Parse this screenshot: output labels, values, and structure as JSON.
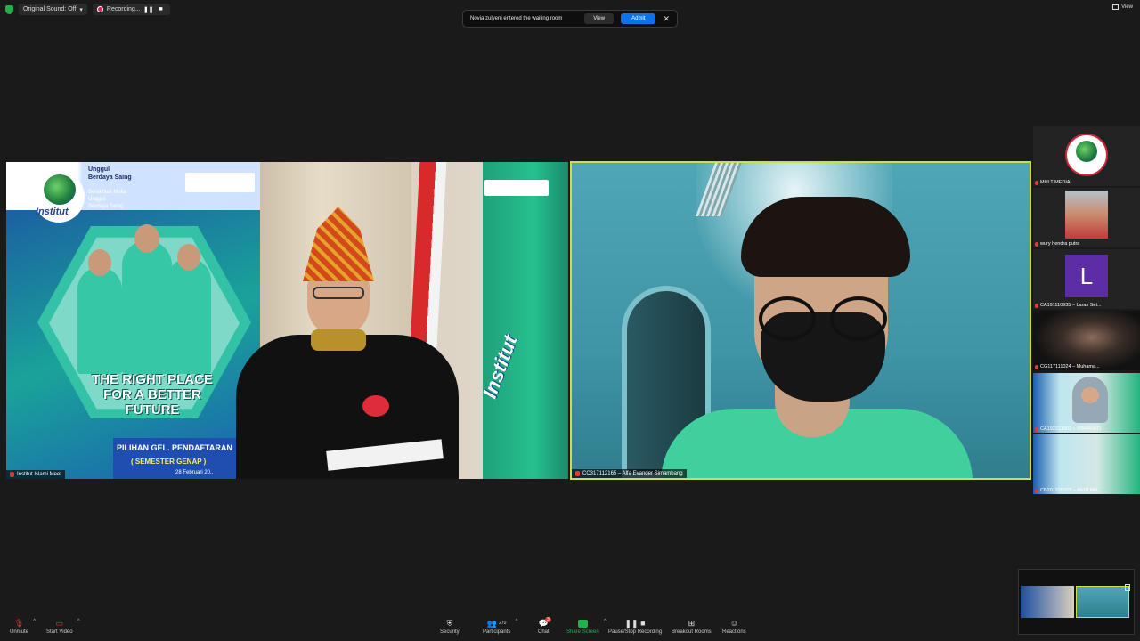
{
  "topbar": {
    "sound_label": "Original Sound: Off",
    "recording_label": "Recording...",
    "view_label": "View"
  },
  "notification": {
    "message": "Novia zulyeni entered the waiting room",
    "view_label": "View",
    "admit_label": "Admit"
  },
  "main_videos": [
    {
      "name": "Institut Islami Meet"
    },
    {
      "name": "CC317112165 – Alfa Evander Simambang"
    }
  ],
  "banner": {
    "logo_text": "Institut",
    "tagline_top": "Unggul\nBerdaya Saing",
    "tagline_sub": "Berakhlak Mulia\nUnggul\nBerdaya Saing",
    "slogan": "THE RIGHT PLACE\nFOR A BETTER\nFUTURE",
    "ribbon_title": "PILIHAN GEL. PENDAFTARAN",
    "ribbon_sub": "( SEMESTER GENAP )",
    "ribbon_date": "28 Februari 20..",
    "flag_text": "Institut"
  },
  "participants": [
    {
      "name": "MULTIMEDIA"
    },
    {
      "name": "wury hendra putra"
    },
    {
      "name": "CA191110935 – Laras Set...",
      "initial": "L"
    },
    {
      "name": "CG117111024 – Muhama..."
    },
    {
      "name": "CA192221902 – IRMAWATI"
    },
    {
      "name": "CB201220329 – ANDI MH..."
    }
  ],
  "toolbar": {
    "unmute": "Unmute",
    "start_video": "Start Video",
    "security": "Security",
    "participants": "Participants",
    "participants_count": "270",
    "chat": "Chat",
    "chat_badge": "3",
    "share_screen": "Share Screen",
    "pause_stop_recording": "Pause/Stop Recording",
    "breakout_rooms": "Breakout Rooms",
    "reactions": "Reactions"
  },
  "colors": {
    "accent": "#0e72ed",
    "active_speaker_border": "#c8e04a",
    "share_green": "#23b04a",
    "record_red": "#e0245e"
  }
}
